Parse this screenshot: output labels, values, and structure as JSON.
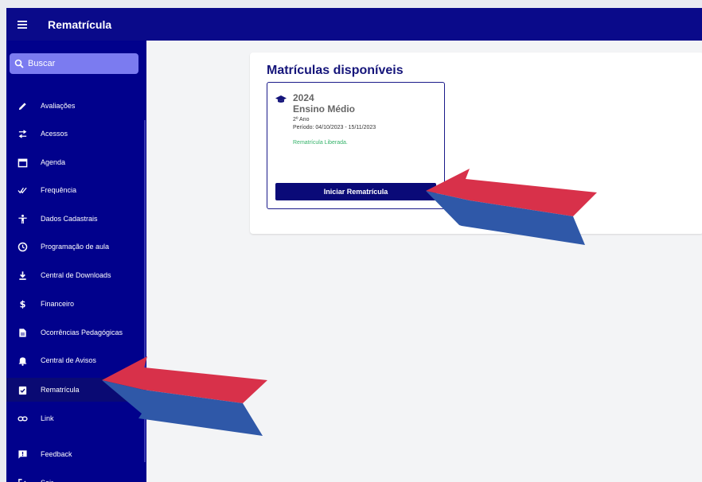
{
  "app": {
    "title": "Rematrícula"
  },
  "search": {
    "placeholder": "Buscar"
  },
  "sidebar": {
    "items": [
      {
        "label": "Avaliações",
        "icon": "pencil-icon"
      },
      {
        "label": "Acessos",
        "icon": "swap-icon"
      },
      {
        "label": "Agenda",
        "icon": "calendar-icon"
      },
      {
        "label": "Frequência",
        "icon": "double-check-icon"
      },
      {
        "label": "Dados Cadastrais",
        "icon": "person-icon"
      },
      {
        "label": "Programação de aula",
        "icon": "clock-icon"
      },
      {
        "label": "Central de Downloads",
        "icon": "download-icon"
      },
      {
        "label": "Financeiro",
        "icon": "dollar-icon"
      },
      {
        "label": "Ocorrências Pedagógicas",
        "icon": "document-icon"
      },
      {
        "label": "Central de Avisos",
        "icon": "bell-icon"
      },
      {
        "label": "Rematrícula",
        "icon": "clipboard-check-icon",
        "active": true
      },
      {
        "label": "Link",
        "icon": "link-icon"
      },
      {
        "label": "Feedback",
        "icon": "feedback-icon"
      },
      {
        "label": "Sair",
        "icon": "logout-icon"
      }
    ]
  },
  "main": {
    "title": "Matrículas disponíveis",
    "enrollment": {
      "year": "2024",
      "level": "Ensino Médio",
      "grade": "2º Ano",
      "period": "Período: 04/10/2023 - 15/11/2023",
      "status": "Rematrícula Liberada.",
      "button_label": "Iniciar Rematrícula"
    }
  },
  "colors": {
    "header": "#0a0a8a",
    "sidebar": "#01018c",
    "status": "#36b36b",
    "arrow_top": "#d8314a",
    "arrow_bottom": "#2f58a8"
  }
}
